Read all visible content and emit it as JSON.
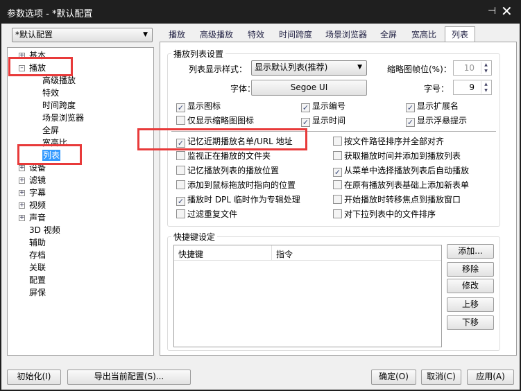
{
  "window": {
    "title": "参数选项 - *默认配置",
    "pin_icon": "pin-icon",
    "close_icon": "close-icon"
  },
  "profile": {
    "selected": "*默认配置"
  },
  "tree": [
    {
      "label": "基本",
      "level": 0,
      "expander": "+"
    },
    {
      "label": "播放",
      "level": 0,
      "expander": "-"
    },
    {
      "label": "高级播放",
      "level": 1
    },
    {
      "label": "特效",
      "level": 1
    },
    {
      "label": "时间跨度",
      "level": 1
    },
    {
      "label": "场景浏览器",
      "level": 1
    },
    {
      "label": "全屏",
      "level": 1
    },
    {
      "label": "宽高比",
      "level": 1
    },
    {
      "label": "列表",
      "level": 1,
      "selected": true
    },
    {
      "label": "设备",
      "level": 0,
      "expander": "+"
    },
    {
      "label": "滤镜",
      "level": 0,
      "expander": "+"
    },
    {
      "label": "字幕",
      "level": 0,
      "expander": "+"
    },
    {
      "label": "视频",
      "level": 0,
      "expander": "+"
    },
    {
      "label": "声音",
      "level": 0,
      "expander": "+"
    },
    {
      "label": "3D 视频",
      "level": 0
    },
    {
      "label": "辅助",
      "level": 0
    },
    {
      "label": "存档",
      "level": 0
    },
    {
      "label": "关联",
      "level": 0
    },
    {
      "label": "配置",
      "level": 0
    },
    {
      "label": "屏保",
      "level": 0
    }
  ],
  "tabs": [
    "播放",
    "高级播放",
    "特效",
    "时间跨度",
    "场景浏览器",
    "全屏",
    "宽高比",
    "列表"
  ],
  "active_tab": "列表",
  "playlist_settings": {
    "title": "播放列表设置",
    "style_label": "列表显示样式：",
    "style_value": "显示默认列表(推荐)",
    "font_label": "字体：",
    "font_value": "Segoe UI",
    "thumb_label": "缩略图帧位(%)：",
    "thumb_value": "10",
    "size_label": "字号：",
    "size_value": "9",
    "display_checks": [
      {
        "label": "显示图标",
        "checked": true
      },
      {
        "label": "显示编号",
        "checked": true
      },
      {
        "label": "显示扩展名",
        "checked": true
      },
      {
        "label": "仅显示缩略图图标",
        "checked": false
      },
      {
        "label": "显示时间",
        "checked": true
      },
      {
        "label": "显示浮悬提示",
        "checked": true
      }
    ],
    "left_checks": [
      {
        "label": "记忆近期播放名单/URL 地址",
        "checked": true
      },
      {
        "label": "监视正在播放的文件夹",
        "checked": false
      },
      {
        "label": "记忆播放列表的播放位置",
        "checked": false
      },
      {
        "label": "添加到鼠标拖放时指向的位置",
        "checked": false
      },
      {
        "label": "播放时 DPL 临时作为专辑处理",
        "checked": true
      },
      {
        "label": "过滤重复文件",
        "checked": false
      }
    ],
    "right_checks": [
      {
        "label": "按文件路径排序并全部对齐",
        "checked": false
      },
      {
        "label": "获取播放时间并添加到播放列表",
        "checked": false
      },
      {
        "label": "从菜单中选择播放列表后自动播放",
        "checked": true
      },
      {
        "label": "在原有播放列表基础上添加新表单",
        "checked": false
      },
      {
        "label": "开始播放时转移焦点到播放窗口",
        "checked": false
      },
      {
        "label": "对下拉列表中的文件排序",
        "checked": false
      }
    ]
  },
  "shortcuts": {
    "title": "快捷键设定",
    "columns": [
      "快捷键",
      "指令"
    ],
    "buttons": [
      "添加...",
      "移除",
      "修改",
      "上移",
      "下移"
    ]
  },
  "footer": {
    "init": "初始化(I)",
    "export": "导出当前配置(S)...",
    "ok": "确定(O)",
    "cancel": "取消(C)",
    "apply": "应用(A)"
  },
  "colors": {
    "highlight": "#e83a3a",
    "selection": "#3399ff"
  }
}
